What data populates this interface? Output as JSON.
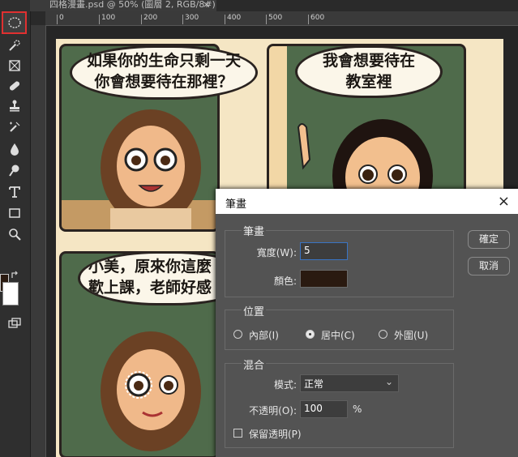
{
  "document_tab": {
    "title": "四格漫畫.psd @ 50% (圖層 2, RGB/8#) *",
    "close_glyph": "×"
  },
  "ruler_labels": [
    "0",
    "100",
    "200",
    "300",
    "400",
    "500",
    "600"
  ],
  "comic": {
    "panel1_bubble": [
      "如果你的生命只剩一天",
      "你會想要待在那裡？"
    ],
    "panel2_bubble": [
      "我會想要待在",
      "教室裡"
    ],
    "panel3_bubble": [
      "小美，原來你這麼",
      "歡上課，老師好感"
    ]
  },
  "dialog": {
    "title": "筆畫",
    "close_glyph": "×",
    "stroke_group": {
      "title": "筆畫",
      "width_label": "寬度(W):",
      "width_value": "5",
      "color_label": "顏色:",
      "color_value": "#2a1a10"
    },
    "position_group": {
      "title": "位置",
      "options": [
        "內部(I)",
        "居中(C)",
        "外圍(U)"
      ],
      "selected": "居中(C)"
    },
    "blend_group": {
      "title": "混合",
      "mode_label": "模式:",
      "mode_value": "正常",
      "opacity_label": "不透明(O):",
      "opacity_value": "100",
      "opacity_unit": "%",
      "preserve_label": "保留透明(P)",
      "preserve_checked": false
    },
    "ok_label": "確定",
    "cancel_label": "取消"
  },
  "toolbar": {
    "tools": [
      "elliptical-marquee",
      "quick-selection",
      "frame",
      "healing-brush",
      "clone-stamp",
      "history-brush",
      "blur",
      "dodge",
      "type",
      "rectangle",
      "zoom"
    ],
    "foreground_color": "#2a1a10",
    "background_color": "#ffffff"
  }
}
